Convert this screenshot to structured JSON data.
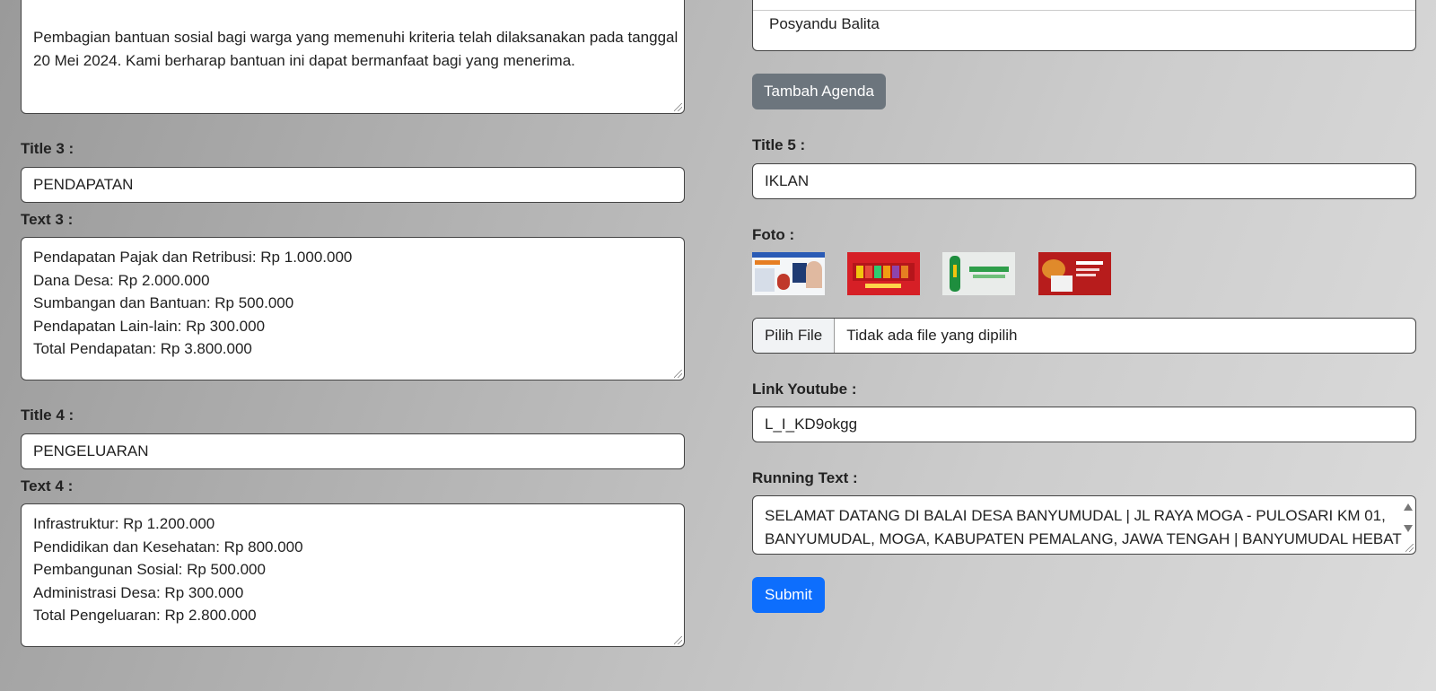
{
  "left": {
    "text2_value_lines": [
      "Pembagian bantuan sosial bagi warga yang memenuhi kriteria telah dilaksanakan pada tanggal",
      "20 Mei 2024. Kami berharap bantuan ini dapat bermanfaat bagi yang menerima."
    ],
    "title3_label": "Title 3 :",
    "title3_value": "PENDAPATAN",
    "text3_label": "Text 3 :",
    "text3_lines": [
      "Pendapatan Pajak dan Retribusi: Rp 1.000.000",
      "Dana Desa: Rp 2.000.000",
      "Sumbangan dan Bantuan: Rp 500.000",
      "Pendapatan Lain-lain: Rp 300.000",
      "Total Pendapatan: Rp 3.800.000"
    ],
    "title4_label": "Title 4 :",
    "title4_value": "PENGELUARAN",
    "text4_label": "Text 4 :",
    "text4_lines": [
      "Infrastruktur: Rp 1.200.000",
      "Pendidikan dan Kesehatan: Rp 800.000",
      "Pembangunan Sosial: Rp 500.000",
      "Administrasi Desa: Rp 300.000",
      "Total Pengeluaran: Rp 2.800.000"
    ]
  },
  "right": {
    "agenda_item": "Posyandu Balita",
    "add_agenda_button": "Tambah Agenda",
    "title5_label": "Title 5 :",
    "title5_value": "IKLAN",
    "foto_label": "Foto :",
    "file_button": "Pilih File",
    "file_status": "Tidak ada file yang dipilih",
    "youtube_label": "Link Youtube :",
    "youtube_value": "L_I_KD9okgg",
    "running_label": "Running Text :",
    "running_lines": [
      "SELAMAT DATANG DI BALAI DESA BANYUMUDAL | JL RAYA MOGA - PULOSARI KM 01,",
      "BANYUMUDAL, MOGA, KABUPATEN PEMALANG, JAWA TENGAH | BANYUMUDAL HEBAT"
    ],
    "submit_button": "Submit"
  },
  "colors": {
    "secondary_button": "#6c757d",
    "primary_button": "#0d6efd"
  }
}
